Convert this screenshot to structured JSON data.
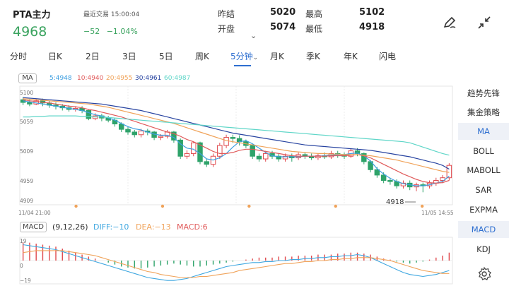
{
  "header": {
    "title": "PTA主力",
    "last_trade": "最近交易 15:00:04",
    "price": "4968",
    "change": "−52",
    "change_pct": "−1.04%",
    "quote_labels": {
      "prev_close": "昨结",
      "open": "开盘",
      "high": "最高",
      "low": "最低"
    },
    "quote_values": {
      "prev_close": "5020",
      "open": "5074",
      "high": "5102",
      "low": "4918"
    },
    "expand_glyph": "⌄"
  },
  "tabs": [
    "分时",
    "日K",
    "2日",
    "3日",
    "5日",
    "周K",
    "5分钟",
    "月K",
    "季K",
    "年K",
    "闪电"
  ],
  "active_tab": "5分钟",
  "tab_arrow": "⌄",
  "ma_legend": {
    "chip": "MA",
    "items": [
      {
        "text": "5:4948",
        "color": "#3f9fe0"
      },
      {
        "text": "10:4940",
        "color": "#e05a5a"
      },
      {
        "text": "20:4955",
        "color": "#f0a35a"
      },
      {
        "text": "30:4961",
        "color": "#2743a0"
      },
      {
        "text": "60:4987",
        "color": "#5fd6c8"
      }
    ]
  },
  "side_menu": [
    "趋势先锋",
    "集金策略",
    "MA",
    "BOLL",
    "MABOLL",
    "SAR",
    "EXPMA",
    "MACD",
    "KDJ"
  ],
  "side_active": [
    "MA",
    "MACD"
  ],
  "macd_legend": {
    "chip": "MACD",
    "params": "(9,12,26)",
    "items": [
      {
        "text": "DIFF:−10",
        "color": "#3fa7e0"
      },
      {
        "text": "DEA:−13",
        "color": "#f0a35a"
      },
      {
        "text": "MACD:6",
        "color": "#e05a5a"
      }
    ]
  },
  "chart_data": {
    "type": "candlestick",
    "price_axis_labels": [
      "5100",
      "5059",
      "5009",
      "4959",
      "4909"
    ],
    "ylim": [
      4900,
      5110
    ],
    "time_start": "11/04 21:00",
    "time_end": "11/05 14:55",
    "low_marker": "4918",
    "candles": [
      [
        5090,
        5085,
        5095,
        5080
      ],
      [
        5085,
        5082,
        5090,
        5078
      ],
      [
        5082,
        5088,
        5092,
        5080
      ],
      [
        5088,
        5084,
        5092,
        5078
      ],
      [
        5084,
        5080,
        5088,
        5075
      ],
      [
        5080,
        5078,
        5085,
        5072
      ],
      [
        5078,
        5075,
        5082,
        5070
      ],
      [
        5075,
        5072,
        5080,
        5068
      ],
      [
        5072,
        5074,
        5078,
        5068
      ],
      [
        5074,
        5070,
        5078,
        5065
      ],
      [
        5070,
        5055,
        5072,
        5052
      ],
      [
        5055,
        5060,
        5065,
        5052
      ],
      [
        5060,
        5056,
        5064,
        5050
      ],
      [
        5056,
        5052,
        5060,
        5048
      ],
      [
        5052,
        5045,
        5056,
        5040
      ],
      [
        5045,
        5035,
        5048,
        5030
      ],
      [
        5035,
        5030,
        5040,
        5025
      ],
      [
        5030,
        5025,
        5034,
        5020
      ],
      [
        5025,
        5032,
        5036,
        5020
      ],
      [
        5032,
        5030,
        5036,
        5024
      ],
      [
        5030,
        5020,
        5032,
        5015
      ],
      [
        5020,
        5022,
        5026,
        5015
      ],
      [
        5022,
        5030,
        5034,
        5018
      ],
      [
        5030,
        5015,
        5032,
        5010
      ],
      [
        5015,
        4985,
        5018,
        4980
      ],
      [
        4985,
        4990,
        4996,
        4980
      ],
      [
        4990,
        5010,
        5012,
        4985
      ],
      [
        5010,
        4975,
        5012,
        4970
      ],
      [
        4975,
        4970,
        4980,
        4965
      ],
      [
        4970,
        4985,
        4990,
        4965
      ],
      [
        4985,
        5005,
        5010,
        4980
      ],
      [
        5005,
        5020,
        5025,
        5000
      ],
      [
        5020,
        5018,
        5025,
        5010
      ],
      [
        5018,
        5012,
        5024,
        5005
      ],
      [
        5012,
        5005,
        5016,
        5000
      ],
      [
        5005,
        4985,
        5008,
        4980
      ],
      [
        4985,
        4980,
        4990,
        4975
      ],
      [
        4980,
        4990,
        4995,
        4975
      ],
      [
        4990,
        4985,
        4995,
        4980
      ],
      [
        4985,
        4980,
        4990,
        4975
      ],
      [
        4980,
        4985,
        4990,
        4975
      ],
      [
        4985,
        4982,
        4990,
        4975
      ],
      [
        4982,
        4988,
        4992,
        4978
      ],
      [
        4988,
        4985,
        4992,
        4980
      ],
      [
        4985,
        4982,
        4990,
        4978
      ],
      [
        4982,
        4986,
        4990,
        4978
      ],
      [
        4986,
        4984,
        4992,
        4980
      ],
      [
        4984,
        4990,
        4995,
        4980
      ],
      [
        4990,
        4988,
        4995,
        4982
      ],
      [
        4988,
        4985,
        4992,
        4980
      ],
      [
        4985,
        4995,
        5000,
        4982
      ],
      [
        4995,
        4990,
        5000,
        4985
      ],
      [
        4990,
        4975,
        4992,
        4970
      ],
      [
        4975,
        4960,
        4978,
        4955
      ],
      [
        4960,
        4950,
        4965,
        4945
      ],
      [
        4950,
        4940,
        4955,
        4935
      ],
      [
        4940,
        4938,
        4945,
        4932
      ],
      [
        4938,
        4930,
        4942,
        4925
      ],
      [
        4930,
        4935,
        4940,
        4925
      ],
      [
        4935,
        4928,
        4940,
        4922
      ],
      [
        4928,
        4932,
        4936,
        4920
      ],
      [
        4932,
        4930,
        4936,
        4918
      ],
      [
        4930,
        4935,
        4940,
        4925
      ],
      [
        4935,
        4940,
        4945,
        4930
      ],
      [
        4940,
        4945,
        4950,
        4935
      ],
      [
        4945,
        4968,
        4972,
        4940
      ]
    ],
    "ma_series": [
      {
        "name": "MA5",
        "color": "#3f9fe0",
        "values": [
          5088,
          5086,
          5084,
          5082,
          5080,
          5078,
          5076,
          5074,
          5072,
          5070,
          5066,
          5062,
          5060,
          5056,
          5052,
          5046,
          5040,
          5036,
          5034,
          5030,
          5026,
          5024,
          5024,
          5020,
          5008,
          5000,
          4998,
          4990,
          4980,
          4978,
          4982,
          4990,
          5002,
          5012,
          5014,
          5008,
          5000,
          4992,
          4986,
          4984,
          4984,
          4984,
          4984,
          4985,
          4985,
          4985,
          4986,
          4987,
          4988,
          4988,
          4990,
          4991,
          4986,
          4976,
          4962,
          4952,
          4944,
          4938,
          4934,
          4932,
          4930,
          4930,
          4932,
          4935,
          4938,
          4948
        ]
      },
      {
        "name": "MA10",
        "color": "#e05a5a",
        "values": [
          5090,
          5088,
          5087,
          5085,
          5084,
          5082,
          5080,
          5078,
          5077,
          5075,
          5072,
          5070,
          5067,
          5064,
          5061,
          5058,
          5054,
          5050,
          5046,
          5042,
          5038,
          5034,
          5030,
          5027,
          5022,
          5016,
          5012,
          5006,
          5000,
          4994,
          4990,
          4990,
          4992,
          4996,
          4998,
          4998,
          4996,
          4994,
          4992,
          4990,
          4988,
          4986,
          4985,
          4985,
          4985,
          4985,
          4985,
          4986,
          4986,
          4986,
          4987,
          4988,
          4986,
          4982,
          4976,
          4970,
          4964,
          4958,
          4952,
          4947,
          4942,
          4938,
          4936,
          4935,
          4936,
          4940
        ]
      },
      {
        "name": "MA20",
        "color": "#f0a35a",
        "values": [
          5092,
          5091,
          5090,
          5089,
          5088,
          5087,
          5086,
          5085,
          5084,
          5083,
          5082,
          5080,
          5078,
          5076,
          5073,
          5070,
          5067,
          5064,
          5061,
          5058,
          5055,
          5052,
          5049,
          5046,
          5042,
          5038,
          5034,
          5030,
          5026,
          5022,
          5018,
          5014,
          5012,
          5010,
          5008,
          5006,
          5004,
          5002,
          5000,
          4998,
          4996,
          4994,
          4993,
          4992,
          4991,
          4990,
          4990,
          4989,
          4989,
          4988,
          4988,
          4988,
          4987,
          4986,
          4984,
          4982,
          4980,
          4978,
          4975,
          4972,
          4969,
          4966,
          4963,
          4960,
          4957,
          4955
        ]
      },
      {
        "name": "MA30",
        "color": "#2743a0",
        "values": [
          5094,
          5093,
          5092,
          5091,
          5090,
          5089,
          5088,
          5087,
          5086,
          5085,
          5084,
          5083,
          5082,
          5080,
          5078,
          5076,
          5074,
          5072,
          5070,
          5067,
          5064,
          5061,
          5058,
          5055,
          5052,
          5049,
          5046,
          5043,
          5040,
          5037,
          5034,
          5031,
          5028,
          5026,
          5024,
          5022,
          5020,
          5018,
          5016,
          5014,
          5012,
          5010,
          5008,
          5006,
          5005,
          5004,
          5003,
          5002,
          5001,
          5000,
          4999,
          4998,
          4997,
          4996,
          4994,
          4992,
          4990,
          4988,
          4986,
          4984,
          4981,
          4978,
          4975,
          4972,
          4968,
          4961
        ]
      },
      {
        "name": "MA60",
        "color": "#5fd6c8",
        "values": [
          5058,
          5058,
          5059,
          5059,
          5060,
          5060,
          5060,
          5060,
          5060,
          5059,
          5059,
          5058,
          5058,
          5057,
          5056,
          5055,
          5054,
          5053,
          5052,
          5051,
          5050,
          5049,
          5048,
          5047,
          5046,
          5045,
          5044,
          5043,
          5042,
          5041,
          5040,
          5039,
          5038,
          5037,
          5036,
          5035,
          5034,
          5033,
          5032,
          5031,
          5030,
          5029,
          5028,
          5027,
          5026,
          5025,
          5024,
          5023,
          5022,
          5021,
          5020,
          5019,
          5018,
          5017,
          5016,
          5015,
          5014,
          5013,
          5012,
          5010,
          5006,
          5002,
          4998,
          4994,
          4990,
          4987
        ]
      }
    ],
    "macd_axis_labels": [
      "19",
      "0",
      "−19"
    ],
    "macd_ylim": [
      -22,
      22
    ],
    "macd_hist": [
      18,
      18,
      17,
      16,
      15,
      14,
      12,
      10,
      8,
      6,
      4,
      2,
      0,
      -2,
      -4,
      -6,
      -7,
      -8,
      -8,
      -7,
      -6,
      -5,
      -4,
      -3,
      -4,
      -5,
      -6,
      -6,
      -5,
      -4,
      -3,
      -2,
      -1,
      0,
      1,
      2,
      3,
      3,
      3,
      4,
      4,
      4,
      5,
      5,
      5,
      6,
      6,
      6,
      7,
      7,
      8,
      8,
      7,
      6,
      4,
      2,
      1,
      -1,
      -2,
      -3,
      -2,
      -1,
      1,
      3,
      5,
      8
    ],
    "macd_diff": [
      16,
      15,
      14,
      13,
      12,
      11,
      9,
      7,
      5,
      3,
      1,
      -1,
      -3,
      -5,
      -7,
      -9,
      -11,
      -13,
      -15,
      -17,
      -18,
      -19,
      -20,
      -20,
      -19,
      -18,
      -16,
      -14,
      -12,
      -10,
      -8,
      -6,
      -5,
      -4,
      -3,
      -2,
      -2,
      -1,
      -1,
      0,
      0,
      1,
      1,
      2,
      2,
      3,
      3,
      4,
      4,
      5,
      5,
      6,
      5,
      3,
      0,
      -3,
      -6,
      -9,
      -12,
      -14,
      -15,
      -16,
      -15,
      -14,
      -12,
      -10
    ],
    "macd_dea": [
      8,
      9,
      10,
      10,
      10,
      10,
      10,
      9,
      8,
      7,
      6,
      5,
      3,
      1,
      -1,
      -3,
      -5,
      -7,
      -9,
      -11,
      -12,
      -14,
      -15,
      -16,
      -17,
      -17,
      -17,
      -16,
      -16,
      -15,
      -14,
      -13,
      -12,
      -10,
      -9,
      -8,
      -7,
      -6,
      -5,
      -4,
      -3,
      -3,
      -2,
      -1,
      -1,
      0,
      0,
      1,
      1,
      2,
      2,
      3,
      3,
      3,
      2,
      1,
      0,
      -2,
      -4,
      -6,
      -8,
      -10,
      -11,
      -12,
      -13,
      -13
    ]
  }
}
